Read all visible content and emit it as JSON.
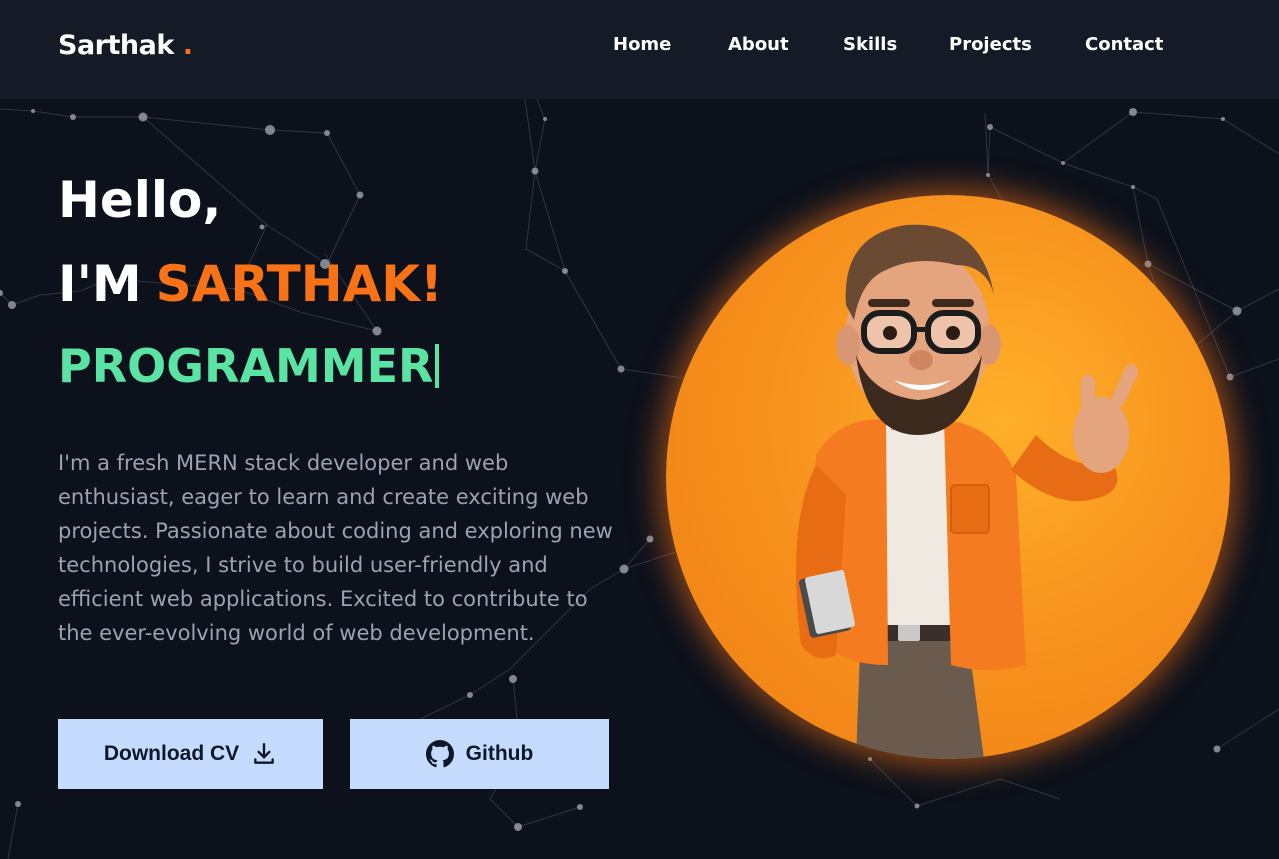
{
  "brand": {
    "name": "Sarthak",
    "dot": "."
  },
  "nav": {
    "items": [
      {
        "label": "Home"
      },
      {
        "label": "About"
      },
      {
        "label": "Skills"
      },
      {
        "label": "Projects"
      },
      {
        "label": "Contact"
      }
    ]
  },
  "hero": {
    "greeting": "Hello,",
    "intro_prefix": "I'M",
    "name": "SARTHAK!",
    "role": "PROGRAMMER",
    "bio": "I'm a fresh MERN stack developer and web enthusiast, eager to learn and create exciting web projects. Passionate about coding and exploring new technologies, I strive to build user-friendly and efficient web applications. Excited to contribute to the ever-evolving world of web development.",
    "buttons": {
      "download_cv": "Download CV",
      "github": "Github"
    }
  },
  "colors": {
    "accent_orange": "#f97316",
    "accent_green": "#5be3a3",
    "button_bg": "#c5dcff",
    "background": "#0c111b",
    "navbar_bg": "#141a26"
  },
  "icons": {
    "download": "download-icon",
    "github": "github-icon"
  }
}
